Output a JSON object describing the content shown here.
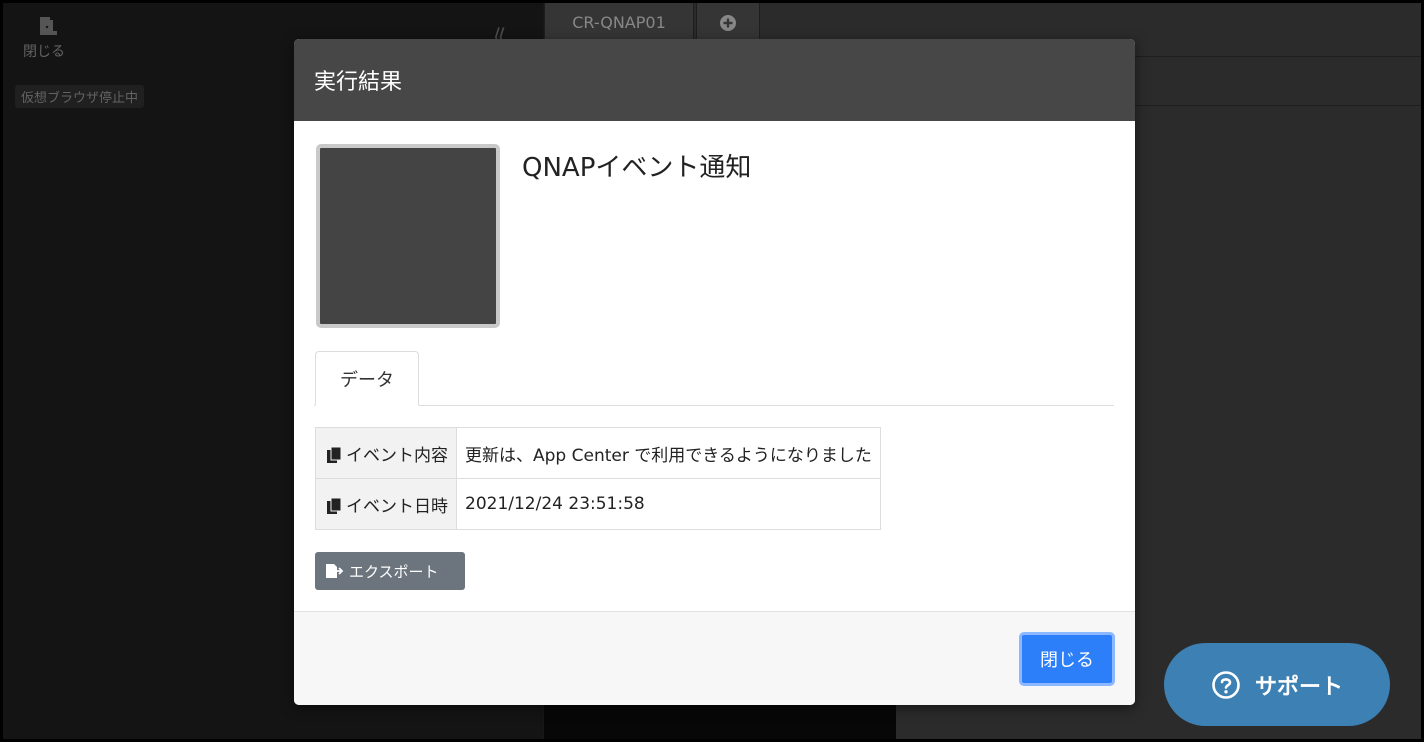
{
  "side": {
    "close_label": "閉じる",
    "vb_status": "仮想ブラウザ停止中"
  },
  "tabs": [
    {
      "label": "CR-QNAP01"
    }
  ],
  "modal": {
    "title": "実行結果",
    "item_title": "QNAPイベント通知",
    "data_tab": "データ",
    "rows": [
      {
        "key": "イベント内容",
        "value": "更新は、App Center で利用できるようになりました"
      },
      {
        "key": "イベント日時",
        "value": "2021/12/24 23:51:58"
      }
    ],
    "export_label": "エクスポート",
    "close_label": "閉じる"
  },
  "support": {
    "label": "サポート"
  },
  "colors": {
    "primary": "#2d7ff9",
    "secondary": "#6c757d",
    "support": "#3d80b4",
    "header": "#474747"
  }
}
